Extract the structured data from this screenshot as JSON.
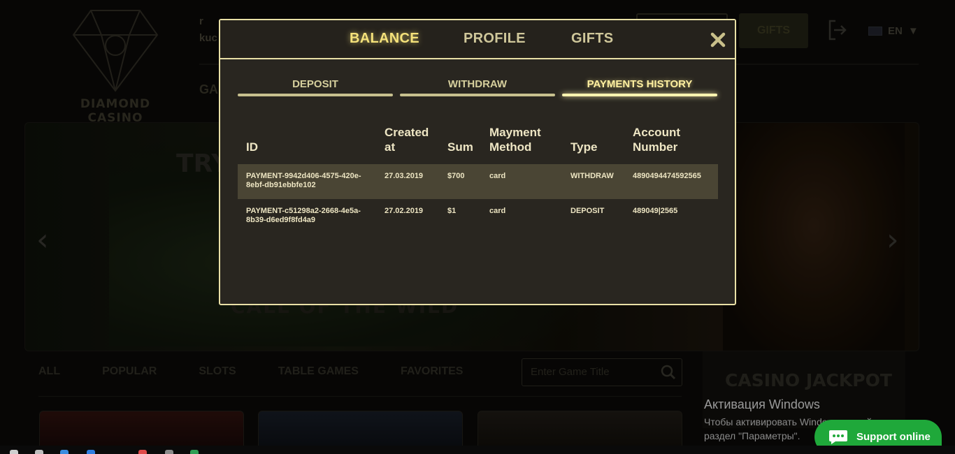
{
  "background": {
    "logo_text": "DIAMOND CASINO",
    "user_name_partial": "kuc",
    "user_initial_partial": "r",
    "nav_partial": "GA",
    "top_gifts_button": "GIFTS",
    "language": "EN",
    "slider_text_top": "TRY",
    "slider_text_bottom": "CALL OF THE WILD",
    "game_tabs": [
      "ALL",
      "POPULAR",
      "SLOTS",
      "TABLE GAMES",
      "FAVORITES"
    ],
    "search_placeholder": "Enter Game Title",
    "jackpot_title": "CASINO JACKPOT"
  },
  "modal": {
    "tabs": [
      "BALANCE",
      "PROFILE",
      "GIFTS"
    ],
    "active_tab": "BALANCE",
    "sub_tabs": [
      "DEPOSIT",
      "WITHDRAW",
      "PAYMENTS HISTORY"
    ],
    "active_sub_tab": "PAYMENTS HISTORY",
    "table": {
      "headers": {
        "id": "ID",
        "created": "Created at",
        "sum": "Sum",
        "method": "Mayment Method",
        "type": "Type",
        "account": "Account Number"
      },
      "rows": [
        {
          "id": "PAYMENT-9942d406-4575-420e-8ebf-db91ebbfe102",
          "created": "27.03.2019",
          "sum": "$700",
          "method": "card",
          "type": "WITHDRAW",
          "account": "4890494474592565"
        },
        {
          "id": "PAYMENT-c51298a2-2668-4e5a-8b39-d6ed9f8fd4a9",
          "created": "27.02.2019",
          "sum": "$1",
          "method": "card",
          "type": "DEPOSIT",
          "account": "489049|2565"
        }
      ]
    }
  },
  "windows_activation": {
    "title": "Активация Windows",
    "body": "Чтобы активировать Windows, перейдите в раздел \"Параметры\"."
  },
  "support": {
    "label": "Support online"
  },
  "colors": {
    "modal_border": "#e9e0a6",
    "active_glow": "#f5e27a",
    "support_green": "#1fa83a"
  }
}
